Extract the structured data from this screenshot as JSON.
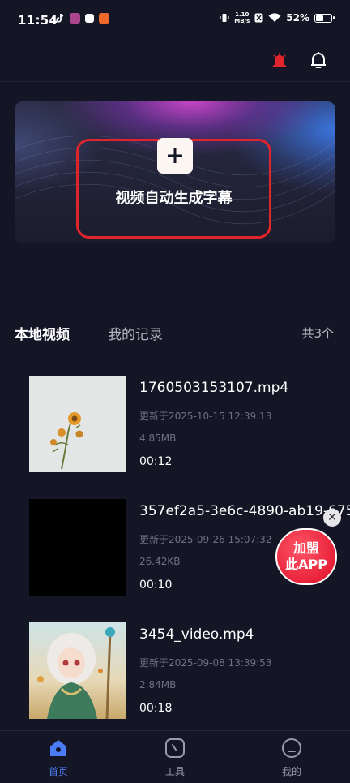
{
  "status_bar": {
    "time": "11:54",
    "net_speed_value": "1.10",
    "net_speed_unit": "MB/s",
    "battery_percent": "52%",
    "battery_level": 0.52
  },
  "header": {
    "alarm_icon": "alarm-light-icon",
    "bell_icon": "bell-icon"
  },
  "hero": {
    "label": "视频自动生成字幕",
    "highlight_color": "#e0242c"
  },
  "tabs": [
    {
      "label": "本地视频",
      "active": true
    },
    {
      "label": "我的记录",
      "active": false
    }
  ],
  "total_count": "共3个",
  "videos": [
    {
      "title": "1760503153107.mp4",
      "updated": "更新于2025-10-15 12:39:13",
      "size": "4.85MB",
      "duration": "00:12"
    },
    {
      "title": "357ef2a5-3e6c-4890-ab19-675",
      "updated": "更新于2025-09-26 15:07:32",
      "size": "26.42KB",
      "duration": "00:10"
    },
    {
      "title": "3454_video.mp4",
      "updated": "更新于2025-09-08 13:39:53",
      "size": "2.84MB",
      "duration": "00:18"
    }
  ],
  "floating_badge": {
    "line1": "加盟",
    "line2": "此APP",
    "close": "✕"
  },
  "bottom_nav": [
    {
      "label": "首页",
      "icon": "home-icon",
      "active": true
    },
    {
      "label": "工具",
      "icon": "tools-icon",
      "active": false
    },
    {
      "label": "我的",
      "icon": "profile-icon",
      "active": false
    }
  ],
  "colors": {
    "background": "#151625",
    "accent_blue": "#4b7cf5",
    "badge_red": "#e8223a"
  }
}
